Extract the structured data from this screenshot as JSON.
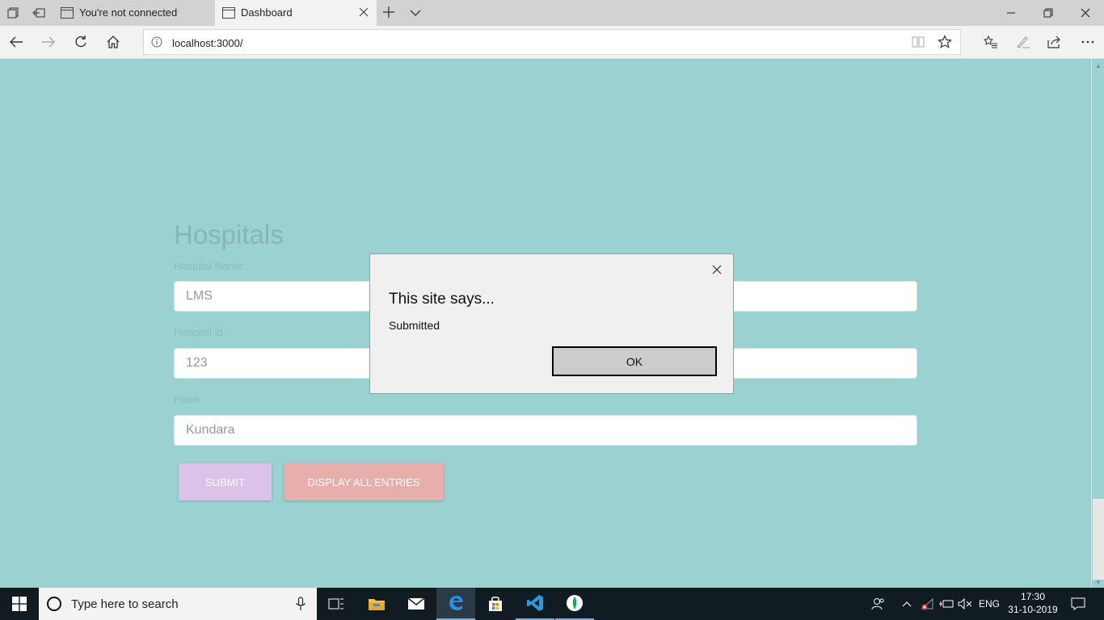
{
  "browser": {
    "tabs": [
      {
        "label": "You're not connected",
        "active": false
      },
      {
        "label": "Dashboard",
        "active": true
      }
    ],
    "url": "localhost:3000/"
  },
  "page": {
    "title": "Hospitals",
    "fields": [
      {
        "label": "Hospital Name:",
        "value": "LMS"
      },
      {
        "label": "Hospital id",
        "value": "123"
      },
      {
        "label": "Place",
        "value": "Kundara"
      }
    ],
    "submit_label": "SUBMIT",
    "display_label": "DISPLAY ALL ENTRIES",
    "background": "#9ad2d1"
  },
  "dialog": {
    "title": "This site says...",
    "message": "Submitted",
    "ok_label": "OK"
  },
  "taskbar": {
    "search_placeholder": "Type here to search",
    "language": "ENG",
    "time": "17:30",
    "date": "31-10-2019"
  }
}
